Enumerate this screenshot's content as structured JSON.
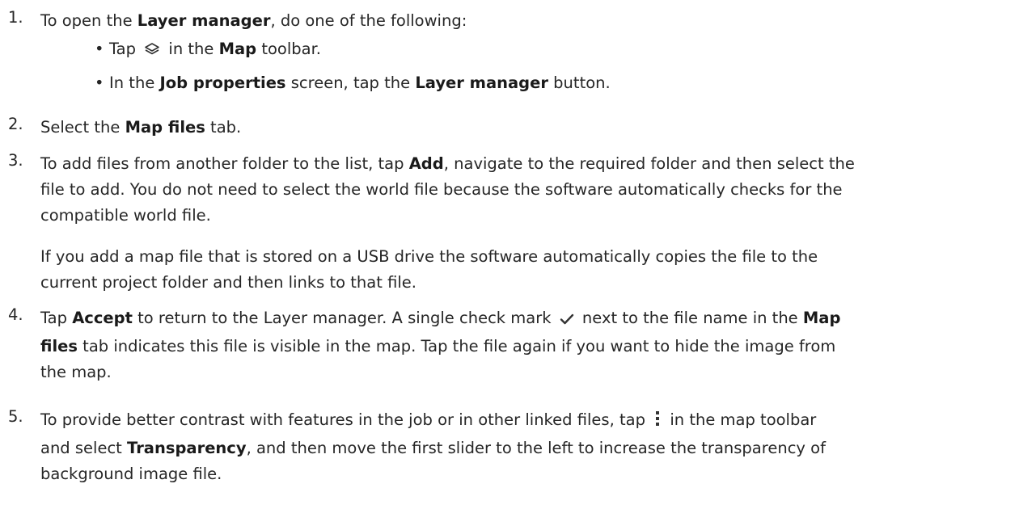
{
  "steps": [
    {
      "number": "1.",
      "pre": "To open the ",
      "bold1": "Layer manager",
      "post": ", do one of the following:",
      "bullets": [
        {
          "pre": "Tap ",
          "icon": "layers-icon",
          "mid": " in the ",
          "bold": "Map",
          "post": " toolbar."
        },
        {
          "pre": "In the ",
          "bold": "Job properties",
          "mid": " screen, tap the ",
          "bold2": "Layer manager",
          "post": " button."
        }
      ]
    },
    {
      "number": "2.",
      "pre": "Select the ",
      "bold": "Map files",
      "post": " tab."
    },
    {
      "number": "3.",
      "l1_pre": "To add files from another folder to the list, tap ",
      "l1_bold": "Add",
      "l1_post": ", navigate to the required folder and then select the",
      "l2": "file to add. You do not need to select the world file because the software automatically checks for the",
      "l3": "compatible world file.",
      "p2_l1": "If you add a map file that is stored on a USB drive the software automatically copies the file to the",
      "p2_l2": "current project folder and then links to that file."
    },
    {
      "number": "4.",
      "l1_pre": "Tap ",
      "l1_bold": "Accept",
      "l1_mid": " to return to the Layer manager. A single check mark ",
      "icon": "check-mark-icon",
      "l1_post": " next to the file name in the ",
      "l1_bold2": "Map",
      "l2_bold": "files",
      "l2_post": " tab indicates this file is visible in the map. Tap the file again if you want to hide the image from",
      "l3": "the map."
    },
    {
      "number": "5.",
      "l1_pre": "To provide better contrast with features in the job or in other linked files, tap ",
      "icon": "more-vertical-icon",
      "l1_post": " in the map toolbar",
      "l2_pre": "and select ",
      "l2_bold": "Transparency",
      "l2_post": ", and then move the first slider to the left to increase the transparency of",
      "l3": "background image file."
    }
  ]
}
